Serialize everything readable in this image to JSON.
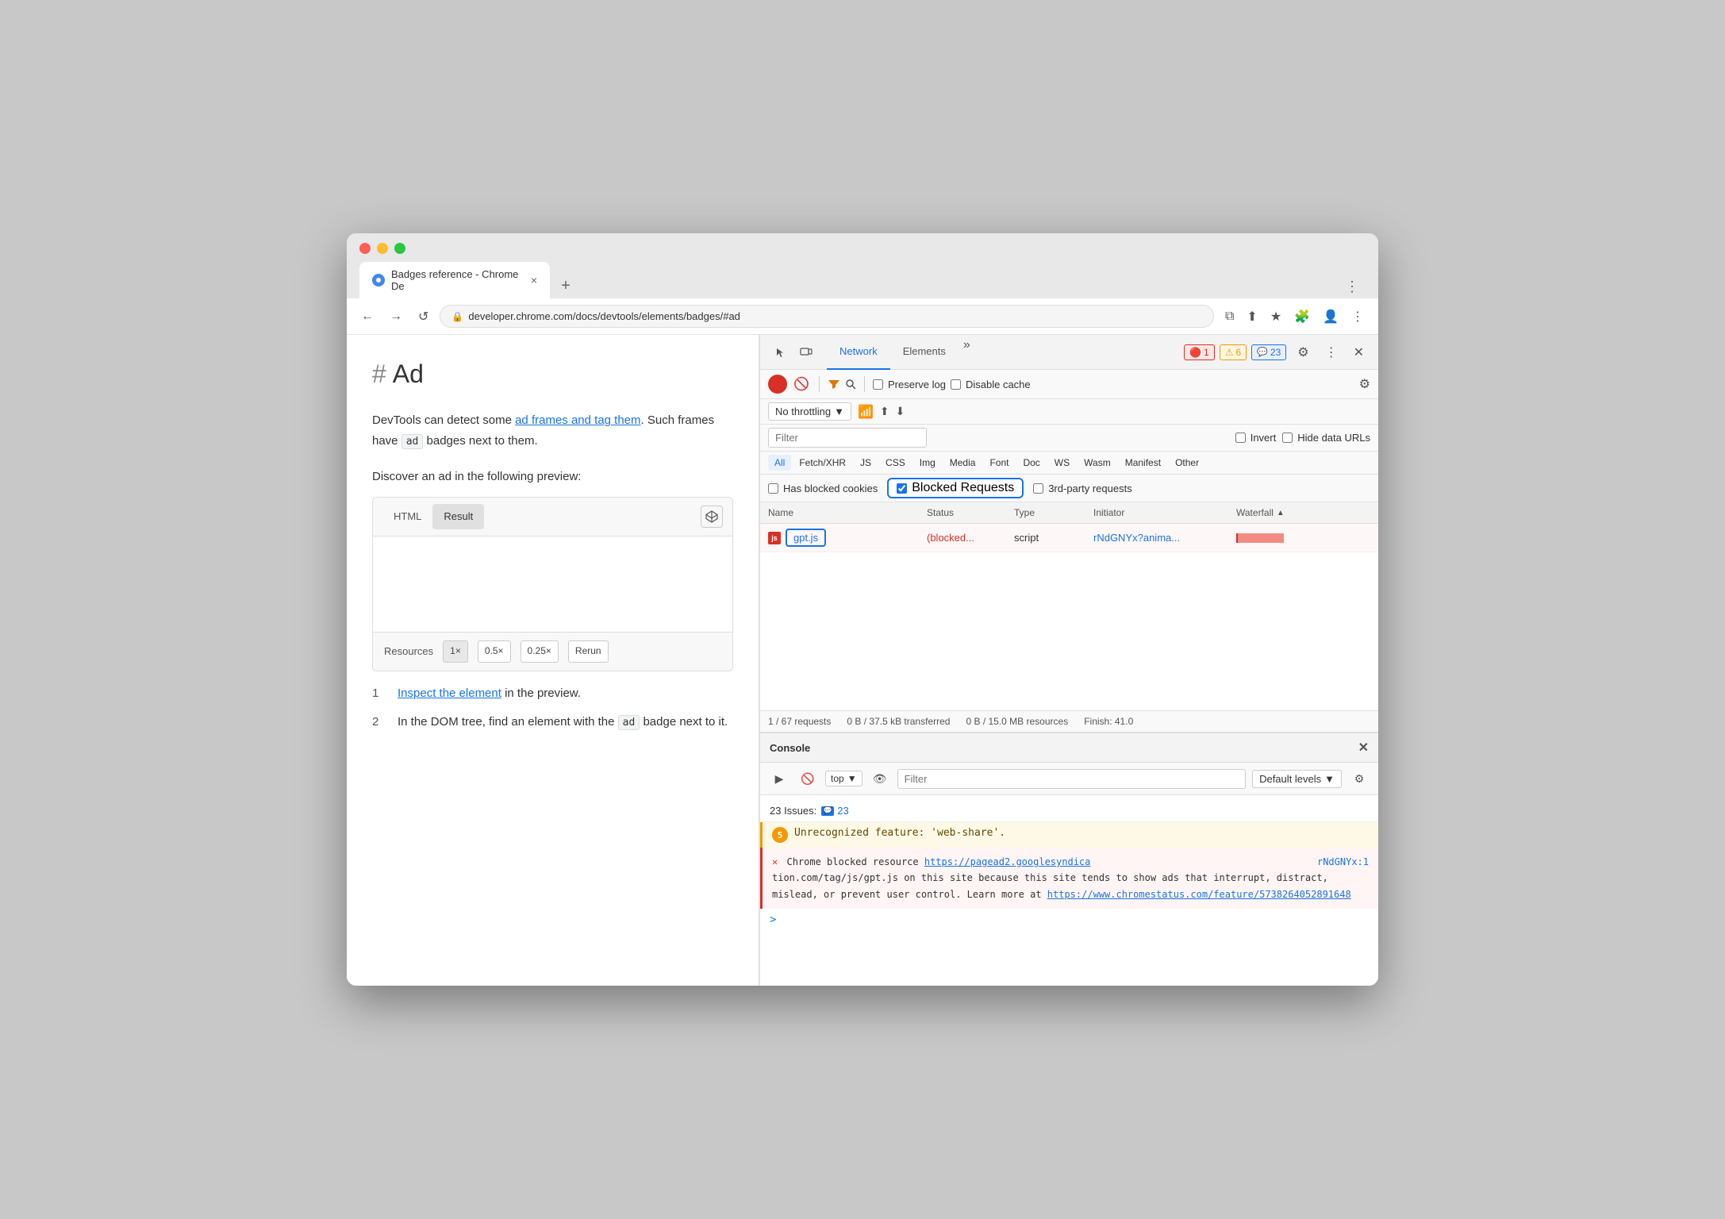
{
  "browser": {
    "tab_title": "Badges reference - Chrome De",
    "tab_favicon": "🔵",
    "new_tab_label": "+",
    "url": "developer.chrome.com/docs/devtools/elements/badges/#ad",
    "nav": {
      "back": "←",
      "forward": "→",
      "reload": "↺",
      "lock": "🔒",
      "more_label": "⋮"
    }
  },
  "page": {
    "title": "Ad",
    "hash": "#",
    "intro": "DevTools can detect some ",
    "link1": "ad frames and tag them",
    "middle": ". Such frames have ",
    "badge_ad": "ad",
    "rest": " badges next to them.",
    "discover": "Discover an ad in the following preview:",
    "preview_tab_html": "HTML",
    "preview_tab_result": "Result",
    "resources_label": "Resources",
    "res_1x": "1×",
    "res_05x": "0.5×",
    "res_025x": "0.25×",
    "res_rerun": "Rerun",
    "step1_num": "1",
    "step1_link": "Inspect the element",
    "step1_rest": " in the preview.",
    "step2_num": "2",
    "step2_text": "In the DOM tree, find an element with the ",
    "step2_badge": "ad",
    "step2_end": " badge next to it."
  },
  "devtools": {
    "tabs": [
      "Network",
      "Elements"
    ],
    "active_tab": "Network",
    "more_icon": "»",
    "badge_error_icon": "🔴",
    "badge_error_count": "1",
    "badge_warning_icon": "⚠",
    "badge_warning_count": "6",
    "badge_info_icon": "💬",
    "badge_info_count": "23",
    "settings_icon": "⚙",
    "menu_icon": "⋮",
    "close_icon": "✕"
  },
  "network": {
    "toolbar": {
      "record_title": "Record",
      "stop_title": "Stop recording",
      "filter_icon": "🔽",
      "search_icon": "🔍",
      "preserve_log_label": "Preserve log",
      "disable_cache_label": "Disable cache",
      "settings_icon": "⚙"
    },
    "toolbar2": {
      "throttle": "No throttling",
      "wifi_icon": "📶",
      "upload_icon": "⬆",
      "download_icon": "⬇"
    },
    "filter": {
      "placeholder": "Filter",
      "invert_label": "Invert",
      "hide_data_urls_label": "Hide data URLs"
    },
    "type_filters": [
      "All",
      "Fetch/XHR",
      "JS",
      "CSS",
      "Img",
      "Media",
      "Font",
      "Doc",
      "WS",
      "Wasm",
      "Manifest",
      "Other"
    ],
    "active_type": "All",
    "blocked": {
      "has_blocked_cookies": "Has blocked cookies",
      "blocked_requests": "Blocked Requests",
      "blocked_checked": true,
      "third_party": "3rd-party requests"
    },
    "table_headers": {
      "name": "Name",
      "status": "Status",
      "type": "Type",
      "initiator": "Initiator",
      "waterfall": "Waterfall"
    },
    "rows": [
      {
        "name": "gpt.js",
        "status": "(blocked...",
        "type": "script",
        "initiator": "rNdGNYx?anima...",
        "waterfall_width": 60
      }
    ],
    "status_bar": {
      "requests": "1 / 67 requests",
      "transferred": "0 B / 37.5 kB transferred",
      "resources": "0 B / 15.0 MB resources",
      "finish": "Finish: 41.0"
    }
  },
  "console": {
    "title": "Console",
    "close_icon": "✕",
    "toolbar": {
      "run_icon": "▶",
      "ban_icon": "🚫",
      "top_label": "top",
      "eye_icon": "👁",
      "filter_placeholder": "Filter",
      "default_levels_label": "Default levels",
      "settings_icon": "⚙"
    },
    "issues_row": "23 Issues: ",
    "issues_count": "23",
    "warning": {
      "count": "5",
      "text": "Unrecognized feature: 'web-share'."
    },
    "error": {
      "icon": "✕",
      "link1": "https://pagead2.googlesyndica",
      "link1_right": "rNdGNYx:1",
      "middle1": "tion.com/tag/js/gpt.js",
      "middle2": " on this site because this site tends to show ads that interrupt, distract, mislead, or prevent user control. Learn more at ",
      "link2": "https://www.chromestatus.com/feature/5738264052891648",
      "prefix": "Chrome blocked resource "
    },
    "prompt_arrow": ">"
  }
}
